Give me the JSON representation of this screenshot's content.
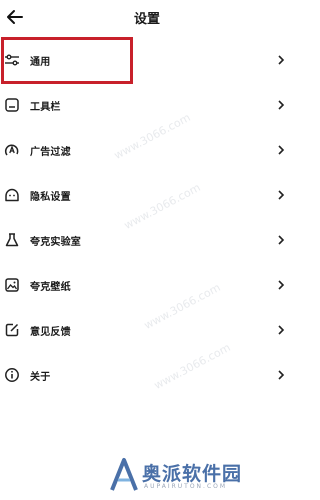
{
  "header": {
    "title": "设置"
  },
  "menu": [
    {
      "label": "通用",
      "icon": "sliders-icon"
    },
    {
      "label": "工具栏",
      "icon": "toolbar-icon"
    },
    {
      "label": "广告过滤",
      "icon": "ad-filter-icon"
    },
    {
      "label": "隐私设置",
      "icon": "privacy-icon"
    },
    {
      "label": "夸克实验室",
      "icon": "flask-icon"
    },
    {
      "label": "夸克壁纸",
      "icon": "wallpaper-icon"
    },
    {
      "label": "意见反馈",
      "icon": "feedback-icon"
    },
    {
      "label": "关于",
      "icon": "info-icon"
    }
  ],
  "watermarks": [
    "www.3066.com",
    "www.3066.com",
    "www.3066.com",
    "www.3066.com"
  ],
  "brand": {
    "name": "奥派软件园",
    "sub": "AUPAIRUTON.COM"
  },
  "colors": {
    "highlight": "#c8202a",
    "brand": "#4a70a8"
  }
}
